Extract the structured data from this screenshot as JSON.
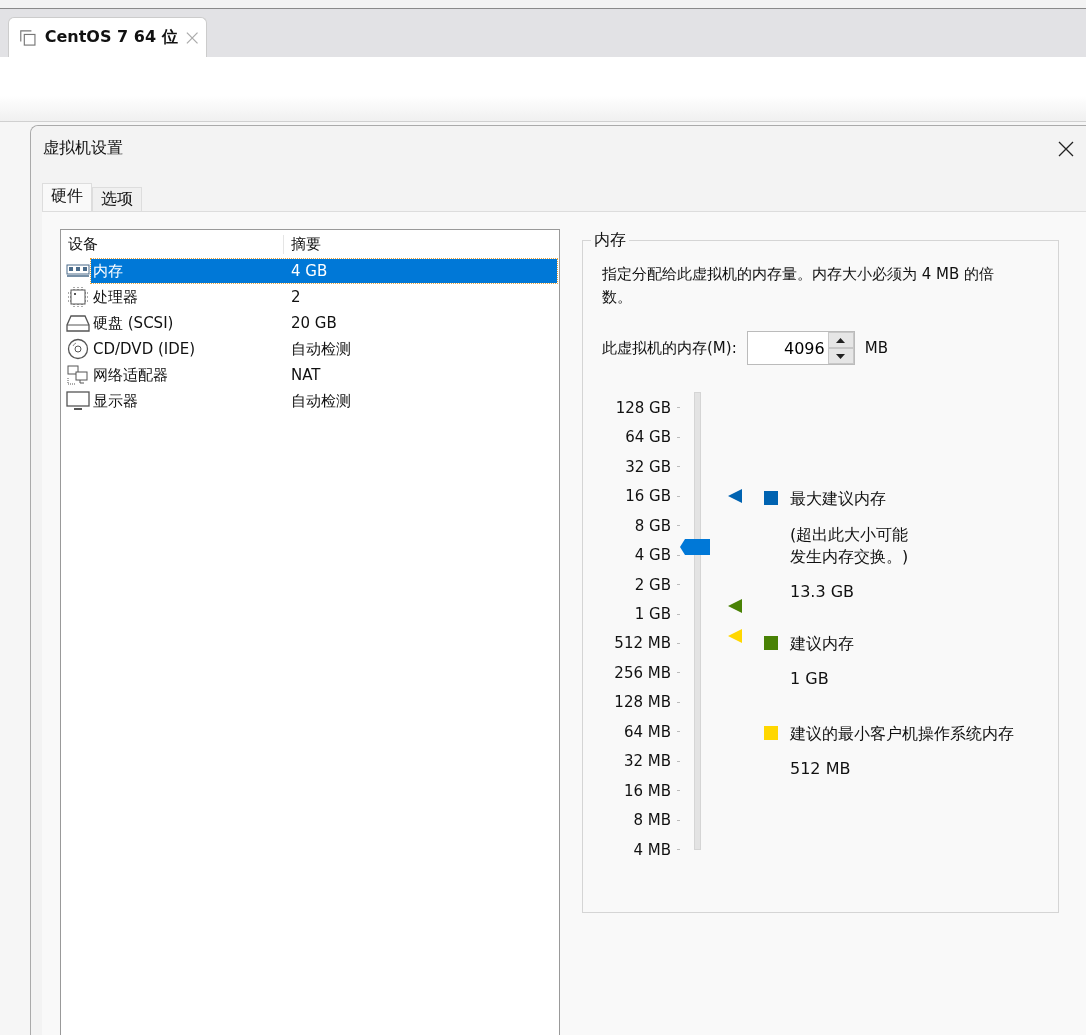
{
  "browser_tab": {
    "title": "CentOS 7 64 位"
  },
  "dialog": {
    "title": "虚拟机设置"
  },
  "tabs": [
    {
      "label": "硬件",
      "selected": true
    },
    {
      "label": "选项",
      "selected": false
    }
  ],
  "device_table": {
    "columns": [
      "设备",
      "摘要"
    ],
    "rows": [
      {
        "kind": "memory",
        "device": "内存",
        "summary": "4 GB",
        "selected": true
      },
      {
        "kind": "processor",
        "device": "处理器",
        "summary": "2",
        "selected": false
      },
      {
        "kind": "disk",
        "device": "硬盘 (SCSI)",
        "summary": "20 GB",
        "selected": false
      },
      {
        "kind": "cd",
        "device": "CD/DVD (IDE)",
        "summary": "自动检测",
        "selected": false
      },
      {
        "kind": "network",
        "device": "网络适配器",
        "summary": "NAT",
        "selected": false
      },
      {
        "kind": "monitor",
        "device": "显示器",
        "summary": "自动检测",
        "selected": false
      }
    ]
  },
  "memory_panel": {
    "legend": "内存",
    "description": "指定分配给此虚拟机的内存量。内存大小必须为 4 MB 的倍数。",
    "field_label": "此虚拟机的内存(M):",
    "field_value": "4096",
    "unit": "MB",
    "slider": {
      "level": 0.6667,
      "ticks": [
        "128 GB",
        "64 GB",
        "32 GB",
        "16 GB",
        "8 GB",
        "4 GB",
        "2 GB",
        "1 GB",
        "512 MB",
        "256 MB",
        "128 MB",
        "64 MB",
        "32 MB",
        "16 MB",
        "8 MB",
        "4 MB"
      ]
    },
    "markers": [
      {
        "color": "#0063b1",
        "level": 0.7826
      },
      {
        "color": "#498205",
        "level": 0.5333
      },
      {
        "color": "#ffd700",
        "level": 0.4667
      }
    ],
    "legend_items": [
      {
        "color": "#0063b1",
        "label": "最大建议内存",
        "note": "(超出此大小可能发生内存交换。)",
        "value": "13.3 GB"
      },
      {
        "color": "#498205",
        "label": "建议内存",
        "value": "1 GB"
      },
      {
        "color": "#ffd700",
        "label": "建议的最小客户机操作系统内存",
        "value": "512 MB"
      }
    ]
  }
}
